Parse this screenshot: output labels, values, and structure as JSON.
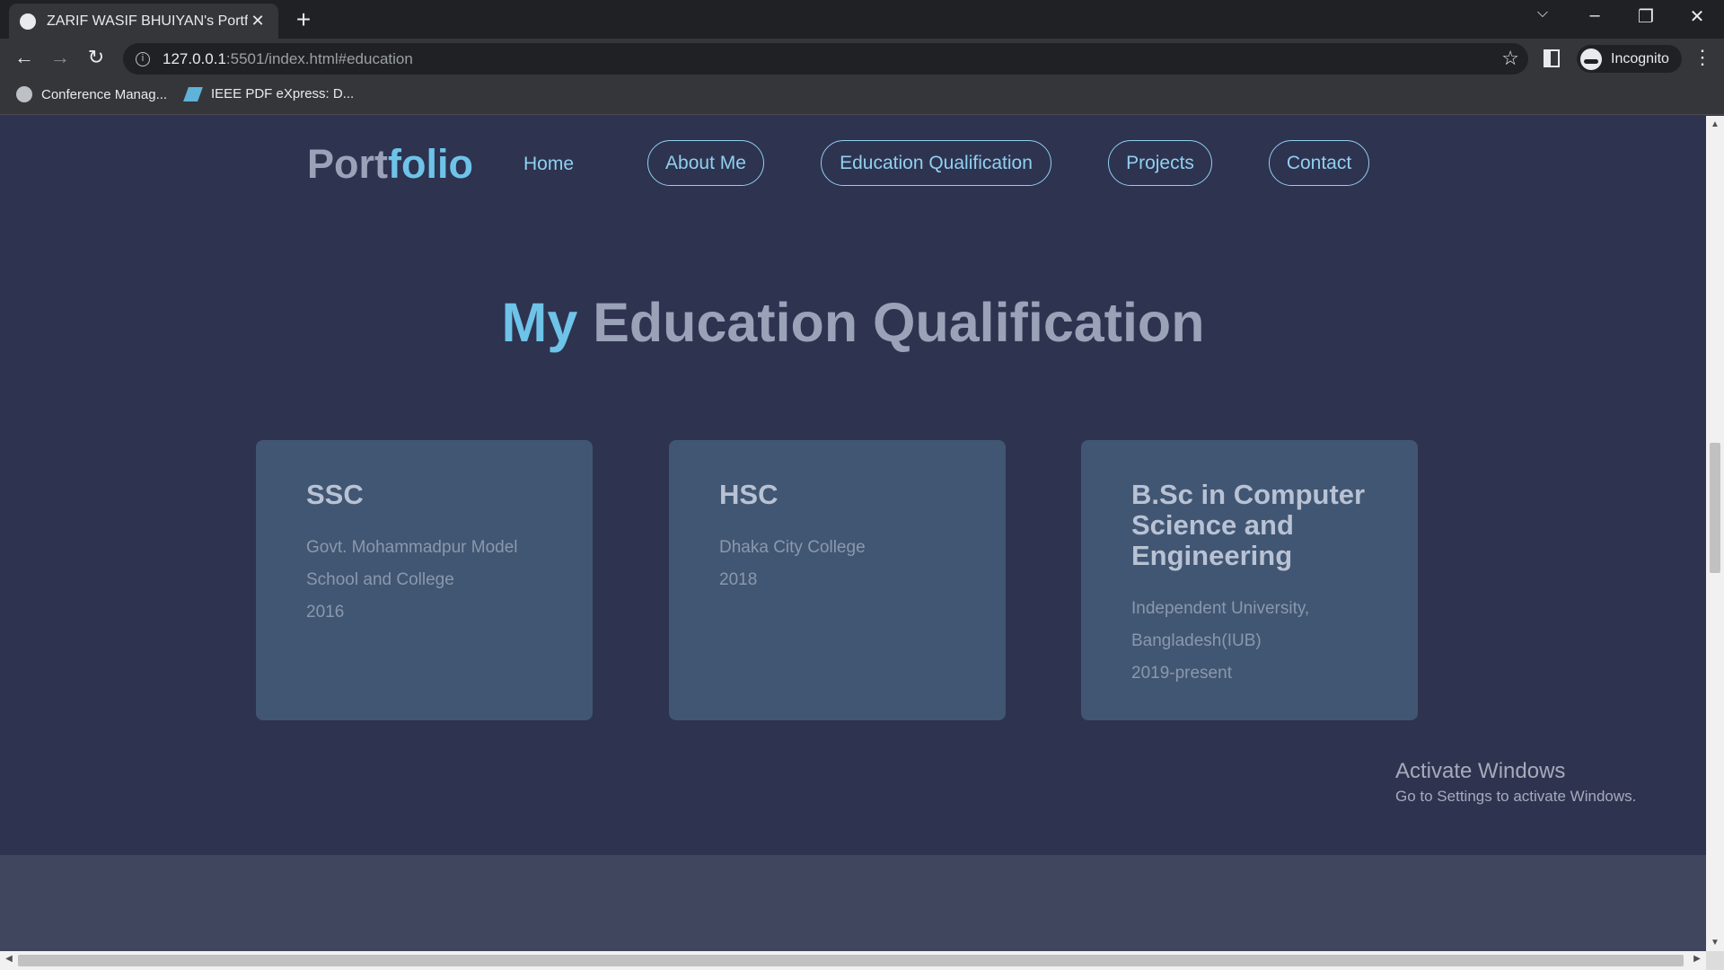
{
  "browser": {
    "tab_title": "ZARIF WASIF BHUIYAN's Portfolio",
    "url_host": "127.0.0.1",
    "url_rest": ":5501/index.html#education",
    "profile_label": "Incognito",
    "bookmarks": [
      "Conference Manag...",
      "IEEE PDF eXpress: D..."
    ]
  },
  "nav": {
    "logo_part1": "Port",
    "logo_part2": "folio",
    "items": [
      "Home",
      "About Me",
      "Education Qualification",
      "Projects",
      "Contact"
    ]
  },
  "section": {
    "title_accent": "My",
    "title_rest": "Education Qualification"
  },
  "cards": [
    {
      "degree": "SSC",
      "institution": "Govt. Mohammadpur Model School and College",
      "year": "2016"
    },
    {
      "degree": "HSC",
      "institution": "Dhaka City College",
      "year": "2018"
    },
    {
      "degree": "B.Sc in Computer Science and Engineering",
      "institution": "Independent University, Bangladesh(IUB)",
      "year": "2019-present"
    }
  ],
  "watermark": {
    "line1": "Activate Windows",
    "line2": "Go to Settings to activate Windows."
  }
}
